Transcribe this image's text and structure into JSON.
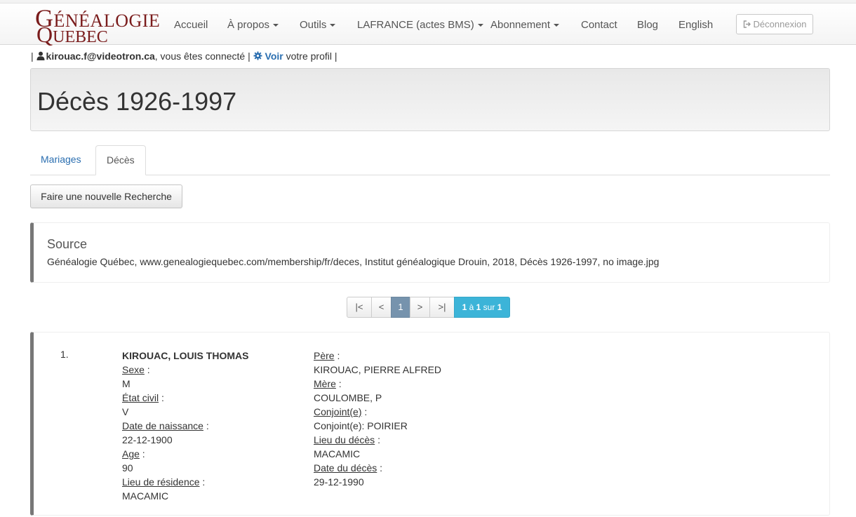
{
  "logo": {
    "line1_big": "G",
    "line1_rest": "ÉNÉALOGIE",
    "line2_big": "Q",
    "line2_rest": "UEBEC"
  },
  "nav": {
    "items": [
      {
        "label": "Accueil",
        "dropdown": false
      },
      {
        "label": "À propos",
        "dropdown": true
      },
      {
        "label": "Outils",
        "dropdown": true
      },
      {
        "label": "LAFRANCE (actes BMS)",
        "dropdown": true
      },
      {
        "label": "Abonnement",
        "dropdown": true
      },
      {
        "label": "Contact",
        "dropdown": false
      },
      {
        "label": "Blog",
        "dropdown": false
      },
      {
        "label": "English",
        "dropdown": false
      }
    ],
    "logout_label": "Déconnexion",
    "logout_icon": "sign-out-icon"
  },
  "user_bar": {
    "separator": "|",
    "email": "kirouac.f@videotron.ca",
    "connected_text": ", vous êtes connecté",
    "view_link": "Voir",
    "profile_text": " votre profil",
    "user_icon": "user-icon",
    "gear_icon": "gear-icon"
  },
  "page_title": "Décès 1926-1997",
  "tabs": [
    {
      "label": "Mariages",
      "active": false
    },
    {
      "label": "Décès",
      "active": true
    }
  ],
  "new_search_label": "Faire une nouvelle Recherche",
  "source": {
    "title": "Source",
    "text": "Généalogie Québec, www.genealogiequebec.com/membership/fr/deces, Institut généalogique Drouin, 2018, Décès 1926-1997, no image.jpg"
  },
  "pagination": {
    "first": "|<",
    "prev": "<",
    "current": "1",
    "next": ">",
    "last": ">|",
    "count_from": "1",
    "count_mid1": " à ",
    "count_to": "1",
    "count_mid2": " sur ",
    "count_total": "1"
  },
  "result": {
    "number": "1.",
    "name": "KIROUAC, LOUIS THOMAS",
    "left_fields": [
      {
        "label": "Sexe",
        "value": "M"
      },
      {
        "label": "État civil",
        "value": "V"
      },
      {
        "label": "Date de naissance",
        "value": "22-12-1900"
      },
      {
        "label": "Age",
        "value": "90"
      },
      {
        "label": "Lieu de résidence",
        "value": "MACAMIC"
      }
    ],
    "right_fields": [
      {
        "label": "Père",
        "value": "KIROUAC, PIERRE ALFRED"
      },
      {
        "label": "Mère",
        "value": "COULOMBE, P"
      },
      {
        "label": "Conjoint(e)",
        "value": "Conjoint(e): POIRIER"
      },
      {
        "label": "Lieu du décès",
        "value": "MACAMIC"
      },
      {
        "label": "Date du décès",
        "value": "29-12-1990"
      }
    ],
    "label_suffix": " :"
  },
  "colors": {
    "brand": "#7a1c1c",
    "link": "#2a6eb0",
    "pager_current": "#7693ad",
    "pager_count": "#3cb4d8"
  }
}
